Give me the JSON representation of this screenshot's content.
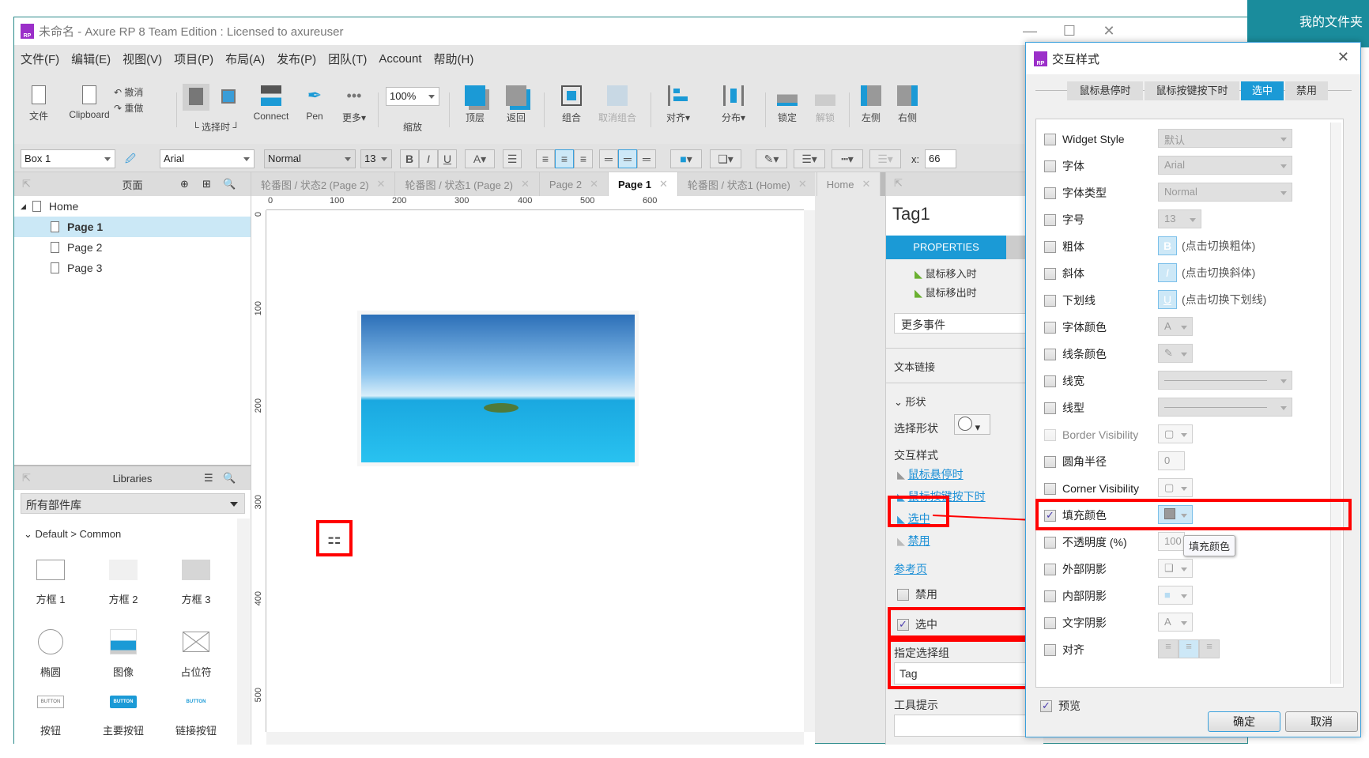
{
  "window": {
    "title": "未命名 - Axure RP 8 Team Edition : Licensed to axureuser",
    "logo": "RP",
    "desktop_label": "我的文件夹"
  },
  "menu": [
    "文件(F)",
    "编辑(E)",
    "视图(V)",
    "项目(P)",
    "布局(A)",
    "发布(P)",
    "团队(T)",
    "Account",
    "帮助(H)"
  ],
  "toolbar": {
    "file": "文件",
    "clipboard": "Clipboard",
    "undo": "撤消",
    "redo": "重做",
    "select_mode": "选择时",
    "connect": "Connect",
    "pen": "Pen",
    "more": "更多▾",
    "zoom_value": "100%",
    "zoom_label": "缩放",
    "top": "顶层",
    "back": "返回",
    "group": "组合",
    "ungroup": "取消组合",
    "align": "对齐▾",
    "distribute": "分布▾",
    "lock": "锁定",
    "unlock": "解锁",
    "left": "左侧",
    "right": "右侧"
  },
  "format": {
    "widget_name": "Box 1",
    "font": "Arial",
    "font_style": "Normal",
    "font_size": "13",
    "bold": "B",
    "italic": "I",
    "underline": "U",
    "x_label": "x:",
    "x_value": "66"
  },
  "pages_panel": {
    "title": "页面",
    "items": [
      {
        "label": "Home",
        "level": 0,
        "selected": false
      },
      {
        "label": "Page 1",
        "level": 1,
        "selected": true
      },
      {
        "label": "Page 2",
        "level": 1,
        "selected": false
      },
      {
        "label": "Page 3",
        "level": 1,
        "selected": false
      }
    ]
  },
  "libraries": {
    "title": "Libraries",
    "selector": "所有部件库",
    "group": "Default > Common",
    "items": [
      "方框 1",
      "方框 2",
      "方框 3",
      "椭圆",
      "图像",
      "占位符",
      "按钮",
      "主要按钮",
      "链接按钮"
    ],
    "button_text": "BUTTON"
  },
  "tabs": [
    {
      "label": "轮番图 / 状态2 (Page 2)",
      "active": false
    },
    {
      "label": "轮番图 / 状态1 (Page 2)",
      "active": false
    },
    {
      "label": "Page 2",
      "active": false
    },
    {
      "label": "Page 1",
      "active": true
    },
    {
      "label": "轮番图 / 状态1 (Home)",
      "active": false
    },
    {
      "label": "Home",
      "active": false
    }
  ],
  "ruler": {
    "h": [
      "0",
      "100",
      "200",
      "300",
      "400",
      "500",
      "600"
    ],
    "v": [
      "0",
      "100",
      "200",
      "300",
      "400",
      "500"
    ]
  },
  "properties": {
    "name": "Tag1",
    "tab": "PROPERTIES",
    "events": [
      "鼠标移入时",
      "鼠标移出时"
    ],
    "more_events": "更多事件",
    "text_link": "文本链接",
    "shape_section": "形状",
    "select_shape": "选择形状",
    "interaction_styles": "交互样式",
    "style_links": [
      "鼠标悬停时",
      "鼠标按键按下时",
      "选中",
      "禁用"
    ],
    "ref_page": "参考页",
    "disabled": "禁用",
    "selected": "选中",
    "selection_group_label": "指定选择组",
    "selection_group_value": "Tag",
    "tooltip_label": "工具提示",
    "tooltip_value": ""
  },
  "dialog": {
    "title": "交互样式",
    "tabs": [
      {
        "label": "鼠标悬停时",
        "active": false
      },
      {
        "label": "鼠标按键按下时",
        "active": false
      },
      {
        "label": "选中",
        "active": true
      },
      {
        "label": "禁用",
        "active": false
      }
    ],
    "rows": [
      {
        "label": "Widget Style",
        "checked": false,
        "value": "默认"
      },
      {
        "label": "字体",
        "checked": false,
        "value": "Arial"
      },
      {
        "label": "字体类型",
        "checked": false,
        "value": "Normal"
      },
      {
        "label": "字号",
        "checked": false,
        "value": "13"
      },
      {
        "label": "粗体",
        "checked": false,
        "value": "(点击切换粗体)"
      },
      {
        "label": "斜体",
        "checked": false,
        "value": "(点击切换斜体)"
      },
      {
        "label": "下划线",
        "checked": false,
        "value": "(点击切换下划线)"
      },
      {
        "label": "字体颜色",
        "checked": false,
        "value": ""
      },
      {
        "label": "线条颜色",
        "checked": false,
        "value": ""
      },
      {
        "label": "线宽",
        "checked": false,
        "value": ""
      },
      {
        "label": "线型",
        "checked": false,
        "value": ""
      },
      {
        "label": "Border Visibility",
        "checked": false,
        "value": ""
      },
      {
        "label": "圆角半径",
        "checked": false,
        "value": "0"
      },
      {
        "label": "Corner Visibility",
        "checked": false,
        "value": ""
      },
      {
        "label": "填充颜色",
        "checked": true,
        "value": ""
      },
      {
        "label": "不透明度 (%)",
        "checked": false,
        "value": "100"
      },
      {
        "label": "外部阴影",
        "checked": false,
        "value": ""
      },
      {
        "label": "内部阴影",
        "checked": false,
        "value": ""
      },
      {
        "label": "文字阴影",
        "checked": false,
        "value": ""
      },
      {
        "label": "对齐",
        "checked": false,
        "value": ""
      }
    ],
    "tooltip": "填充颜色",
    "preview_label": "预览",
    "preview_checked": true,
    "ok": "确定",
    "cancel": "取消"
  },
  "colors": {
    "accent": "#1b9ad6",
    "highlight_red": "#ff0000",
    "selected_row": "#cbe8f6"
  }
}
